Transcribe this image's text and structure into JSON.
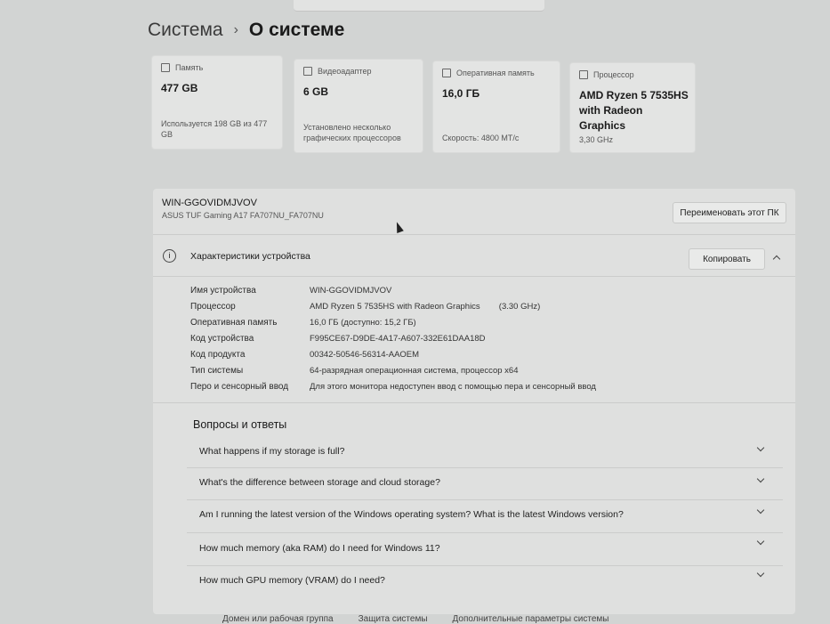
{
  "breadcrumb": {
    "root": "Система",
    "separator": "›",
    "page": "О системе"
  },
  "cards": [
    {
      "title": "Память",
      "value": "477 GB",
      "note": "Используется 198 GB из 477 GB"
    },
    {
      "title": "Видеоадаптер",
      "value": "6 GB",
      "note": "Установлено несколько графических процессоров"
    },
    {
      "title": "Оперативная память",
      "value": "16,0 ГБ",
      "note": "Скорость: 4800 МТ/с"
    },
    {
      "title": "Процессор",
      "value": "AMD Ryzen 5 7535HS with Radeon Graphics",
      "note": "3,30 GHz"
    }
  ],
  "device": {
    "name": "WIN-GGOVIDMJVOV",
    "model": "ASUS TUF Gaming A17 FA707NU_FA707NU",
    "rename_button": "Переименовать этот ПК"
  },
  "specs": {
    "title": "Характеристики устройства",
    "copy_button": "Копировать",
    "rows": [
      {
        "label": "Имя устройства",
        "value": "WIN-GGOVIDMJVOV"
      },
      {
        "label": "Процессор",
        "value": "AMD Ryzen 5 7535HS with Radeon Graphics        (3.30 GHz)"
      },
      {
        "label": "Оперативная память",
        "value": "16,0 ГБ (доступно: 15,2 ГБ)"
      },
      {
        "label": "Код устройства",
        "value": "F995CE67-D9DE-4A17-A607-332E61DAA18D"
      },
      {
        "label": "Код продукта",
        "value": "00342-50546-56314-AAOEM"
      },
      {
        "label": "Тип системы",
        "value": "64-разрядная операционная система, процессор x64"
      },
      {
        "label": "Перо и сенсорный ввод",
        "value": "Для этого монитора недоступен ввод с помощью пера и сенсорный ввод"
      }
    ]
  },
  "faq": {
    "title": "Вопросы и ответы",
    "items": [
      "What happens if my storage is full?",
      "What's the difference between storage and cloud storage?",
      "Am I running the latest version of the Windows operating system? What is the latest Windows version?",
      "How much memory (aka RAM) do I need for Windows 11?",
      "How much GPU memory (VRAM) do I need?"
    ]
  },
  "bottom_links": [
    "Домен или рабочая группа",
    "Защита системы",
    "Дополнительные параметры системы"
  ]
}
